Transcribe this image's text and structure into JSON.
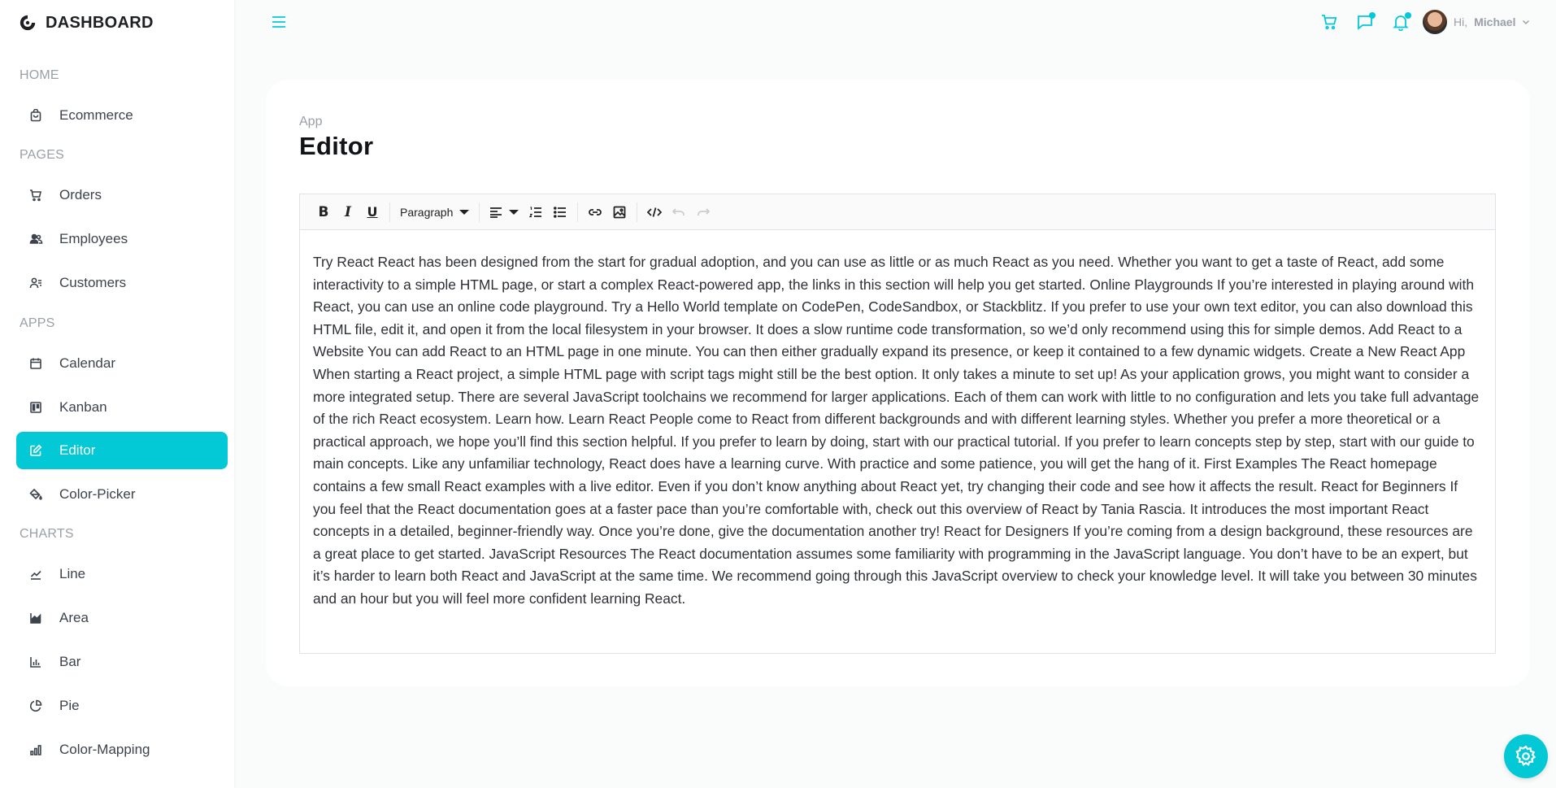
{
  "brand": {
    "name": "DASHBOARD"
  },
  "sidebar": {
    "sections": [
      {
        "title": "HOME",
        "items": [
          {
            "label": "Ecommerce",
            "icon": "shopping-bag-icon"
          }
        ]
      },
      {
        "title": "PAGES",
        "items": [
          {
            "label": "Orders",
            "icon": "cart-icon"
          },
          {
            "label": "Employees",
            "icon": "people-icon"
          },
          {
            "label": "Customers",
            "icon": "user-list-icon"
          }
        ]
      },
      {
        "title": "APPS",
        "items": [
          {
            "label": "Calendar",
            "icon": "calendar-icon"
          },
          {
            "label": "Kanban",
            "icon": "kanban-icon"
          },
          {
            "label": "Editor",
            "icon": "edit-icon",
            "active": true
          },
          {
            "label": "Color-Picker",
            "icon": "paint-bucket-icon"
          }
        ]
      },
      {
        "title": "CHARTS",
        "items": [
          {
            "label": "Line",
            "icon": "line-chart-icon"
          },
          {
            "label": "Area",
            "icon": "area-chart-icon"
          },
          {
            "label": "Bar",
            "icon": "bar-chart-icon"
          },
          {
            "label": "Pie",
            "icon": "pie-chart-icon"
          },
          {
            "label": "Color-Mapping",
            "icon": "stock-chart-icon"
          }
        ]
      }
    ]
  },
  "header": {
    "greeting": "Hi,",
    "user_name": "Michael",
    "icons": [
      "menu-icon",
      "cart-icon",
      "chat-icon",
      "bell-icon",
      "chevron-down-icon"
    ]
  },
  "page": {
    "breadcrumb": "App",
    "title": "Editor"
  },
  "editor": {
    "format_select": "Paragraph",
    "content": "Try React React has been designed from the start for gradual adoption, and you can use as little or as much React as you need. Whether you want to get a taste of React, add some interactivity to a simple HTML page, or start a complex React-powered app, the links in this section will help you get started. Online Playgrounds If you’re interested in playing around with React, you can use an online code playground. Try a Hello World template on CodePen, CodeSandbox, or Stackblitz. If you prefer to use your own text editor, you can also download this HTML file, edit it, and open it from the local filesystem in your browser. It does a slow runtime code transformation, so we’d only recommend using this for simple demos. Add React to a Website You can add React to an HTML page in one minute. You can then either gradually expand its presence, or keep it contained to a few dynamic widgets. Create a New React App When starting a React project, a simple HTML page with script tags might still be the best option. It only takes a minute to set up! As your application grows, you might want to consider a more integrated setup. There are several JavaScript toolchains we recommend for larger applications. Each of them can work with little to no configuration and lets you take full advantage of the rich React ecosystem. Learn how. Learn React People come to React from different backgrounds and with different learning styles. Whether you prefer a more theoretical or a practical approach, we hope you’ll find this section helpful. If you prefer to learn by doing, start with our practical tutorial. If you prefer to learn concepts step by step, start with our guide to main concepts. Like any unfamiliar technology, React does have a learning curve. With practice and some patience, you will get the hang of it. First Examples The React homepage contains a few small React examples with a live editor. Even if you don’t know anything about React yet, try changing their code and see how it affects the result. React for Beginners If you feel that the React documentation goes at a faster pace than you’re comfortable with, check out this overview of React by Tania Rascia. It introduces the most important React concepts in a detailed, beginner-friendly way. Once you’re done, give the documentation another try! React for Designers If you’re coming from a design background, these resources are a great place to get started. JavaScript Resources The React documentation assumes some familiarity with programming in the JavaScript language. You don’t have to be an expert, but it’s harder to learn both React and JavaScript at the same time. We recommend going through this JavaScript overview to check your knowledge level. It will take you between 30 minutes and an hour but you will feel more confident learning React."
  },
  "colors": {
    "accent": "#03c9d7",
    "text": "#33373e",
    "muted": "#9aa0a8"
  }
}
